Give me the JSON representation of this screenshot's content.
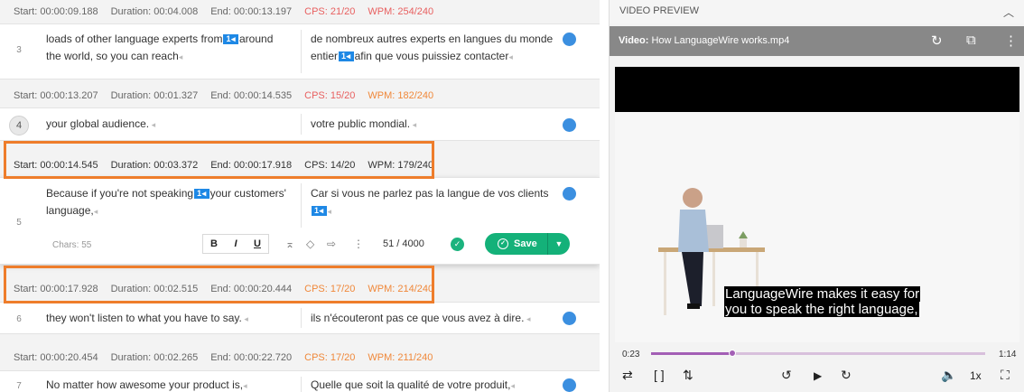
{
  "segments": [
    {
      "num": "",
      "start": "Start: 00:00:09.188",
      "duration": "Duration: 00:04.008",
      "end": "End: 00:00:13.197",
      "cps": "CPS: 21/20",
      "wpm": "WPM: 254/240",
      "src": "",
      "tgt": ""
    },
    {
      "num": "3",
      "src_a": "loads of other language experts from",
      "src_b": "around the world, so you can reach",
      "tgt_a": "de nombreux autres experts en langues du monde entier",
      "tgt_b": "afin que vous puissiez contacter"
    },
    {
      "start": "Start: 00:00:13.207",
      "duration": "Duration: 00:01.327",
      "end": "End: 00:00:14.535",
      "cps": "CPS: 15/20",
      "wpm": "WPM: 182/240"
    },
    {
      "num": "4",
      "src": "your global audience.",
      "tgt": "votre public mondial."
    },
    {
      "start": "Start: 00:00:14.545",
      "duration": "Duration: 00:03.372",
      "end": "End: 00:00:17.918",
      "cps": "CPS: 14/20",
      "wpm": "WPM: 179/240"
    },
    {
      "num": "5",
      "src_a": "Because if you're not speaking",
      "src_b": "your customers' language,",
      "tgt_a": "Car si vous ne parlez pas la langue de vos clients",
      "tgt_b": ""
    },
    {
      "start": "Start: 00:00:17.928",
      "duration": "Duration: 00:02.515",
      "end": "End: 00:00:20.444",
      "cps": "CPS: 17/20",
      "wpm": "WPM: 214/240"
    },
    {
      "num": "6",
      "src": "they won't listen to what you have to say.",
      "tgt": "ils n'écouteront pas ce que vous avez à dire."
    },
    {
      "start": "Start: 00:00:20.454",
      "duration": "Duration: 00:02.265",
      "end": "End: 00:00:22.720",
      "cps": "CPS: 17/20",
      "wpm": "WPM: 211/240"
    },
    {
      "num": "7",
      "src": "No matter how awesome your product is,",
      "tgt": "Quelle que soit la qualité de votre produit,"
    }
  ],
  "tag_label": "1",
  "editor_toolbar": {
    "chars": "Chars: 55",
    "bold": "B",
    "italic": "I",
    "underline": "U",
    "counter": "51 / 4000",
    "save_label": "Save"
  },
  "video": {
    "header": "VIDEO PREVIEW",
    "title_label": "Video:",
    "title_file": "How LanguageWire works.mp4",
    "subtitle_line1": "LanguageWire makes it easy for",
    "subtitle_line2": "you to speak the right language,",
    "current_time": "0:23",
    "total_time": "1:14",
    "progress": 0.243,
    "speed": "1x"
  },
  "colors": {
    "highlight": "#ee7d2b",
    "save": "#14b179",
    "pill": "#1e88e5",
    "warn": "#f0883a",
    "bad": "#e86060",
    "track_fill": "#a35fb5"
  }
}
